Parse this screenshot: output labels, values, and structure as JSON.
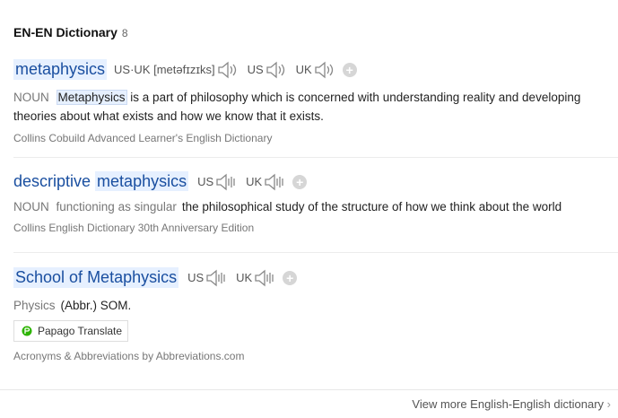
{
  "header": {
    "title": "EN-EN Dictionary",
    "count": "8"
  },
  "entries": [
    {
      "word": "metaphysics",
      "pronunciation": "US·UK [metəfɪzɪks]",
      "label_us": "US",
      "label_uk": "UK",
      "pos": "NOUN",
      "def_highlight": "Metaphysics",
      "def_rest": " is a part of philosophy which is concerned with understanding reality and developing theories about what exists and how we know that it exists.",
      "source": "Collins Cobuild Advanced Learner's English Dictionary"
    },
    {
      "word_prefix": "descriptive ",
      "word_highlight": "metaphysics",
      "label_us": "US",
      "label_uk": "UK",
      "pos": "NOUN",
      "usage": "functioning as singular",
      "definition": "the philosophical study of the structure of how we think about the world",
      "source": "Collins English Dictionary 30th Anniversary Edition"
    },
    {
      "word_prefix": "School of ",
      "word_highlight": "Metaphysics",
      "label_us": "US",
      "label_uk": "UK",
      "category": "Physics",
      "definition": "(Abbr.) SOM.",
      "source": "Acronyms & Abbreviations by Abbreviations.com"
    }
  ],
  "papago_label": "Papago Translate",
  "footer": {
    "view_more": "View more English-English dictionary"
  },
  "colors": {
    "link": "#1a4fa0",
    "highlight": "#e6f0ff",
    "papago": "#2db400"
  }
}
